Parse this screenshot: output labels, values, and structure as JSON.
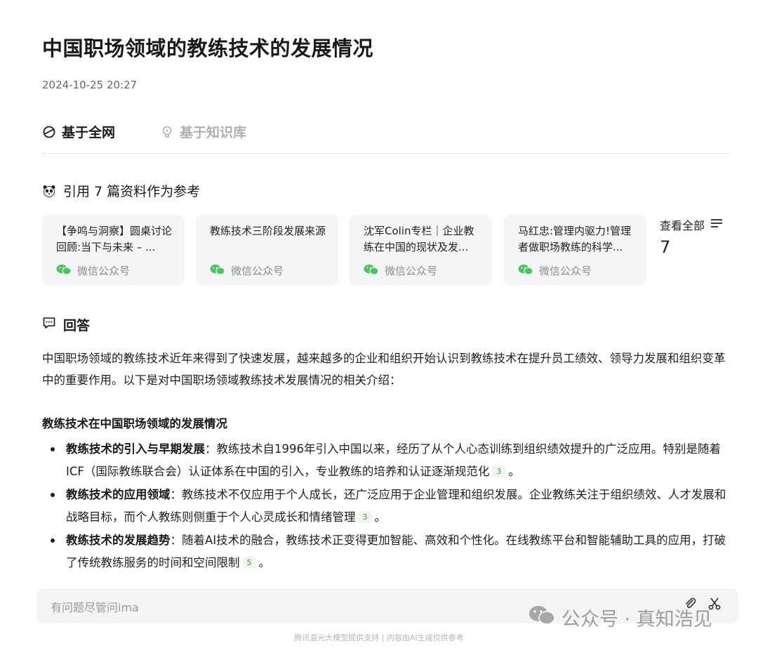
{
  "article": {
    "title": "中国职场领域的教练技术的发展情况",
    "date": "2024-10-25 20:27"
  },
  "tabs": [
    {
      "label": "基于全网",
      "active": true
    },
    {
      "label": "基于知识库",
      "active": false
    }
  ],
  "references": {
    "heading": "引用 7 篇资料作为参考",
    "cards": [
      {
        "title": "【争鸣与洞察】圆桌讨论回顾:当下与未来 – ...",
        "source": "微信公众号"
      },
      {
        "title": "教练技术三阶段发展来源",
        "source": "微信公众号"
      },
      {
        "title": "沈军Colin专栏｜企业教练在中国的现状及发...",
        "source": "微信公众号"
      },
      {
        "title": "马红忠:管理内驱力!管理者做职场教练的科学...",
        "source": "微信公众号"
      }
    ],
    "view_all_label": "查看全部",
    "count": "7"
  },
  "answer": {
    "heading": "回答",
    "intro": "中国职场领域的教练技术近年来得到了快速发展，越来越多的企业和组织开始认识到教练技术在提升员工绩效、领导力发展和组织变革中的重要作用。以下是对中国职场领域教练技术发展情况的相关介绍：",
    "subheading": "教练技术在中国职场领域的发展情况",
    "bullets": [
      {
        "bold": "教练技术的引入与早期发展",
        "text": "：教练技术自1996年引入中国以来，经历了从个人心态训练到组织绩效提升的广泛应用。特别是随着ICF（国际教练联合会）认证体系在中国的引入，专业教练的培养和认证逐渐规范化",
        "cite": "3",
        "end": "。"
      },
      {
        "bold": "教练技术的应用领域",
        "text": "：教练技术不仅应用于个人成长，还广泛应用于企业管理和组织发展。企业教练关注于组织绩效、人才发展和战略目标，而个人教练则侧重于个人心灵成长和情绪管理",
        "cite": "3",
        "end": "。"
      },
      {
        "bold": "教练技术的发展趋势",
        "text": "：随着AI技术的融合，教练技术正变得更加智能、高效和个性化。在线教练平台和智能辅助工具的应用，打破了传统教练服务的时间和空间限制",
        "cite": "5",
        "end": "。"
      }
    ]
  },
  "input": {
    "placeholder": "有问题尽管问ima"
  },
  "footer": "腾讯混元大模型提供支持 | 内容由AI生成仅供参考",
  "watermark": "公众号 · 真知浩见",
  "colors": {
    "accent_green": "#3a9d4a",
    "wechat_green": "#4cc264"
  }
}
